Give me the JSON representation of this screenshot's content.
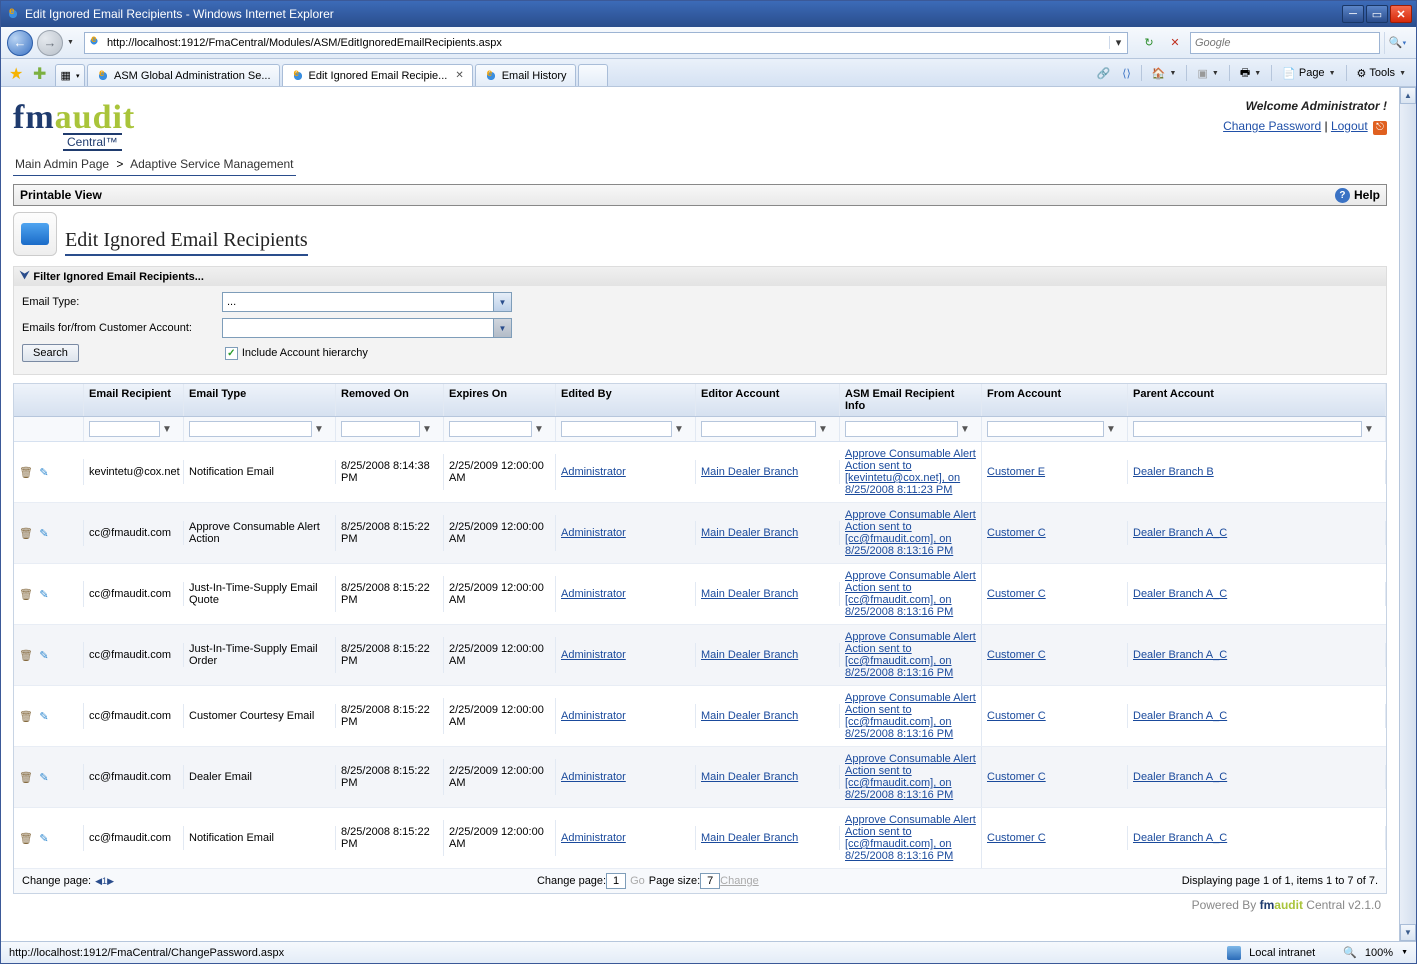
{
  "window": {
    "title": "Edit Ignored Email Recipients - Windows Internet Explorer"
  },
  "nav": {
    "url": "http://localhost:1912/FmaCentral/Modules/ASM/EditIgnoredEmailRecipients.aspx",
    "search_placeholder": "Google"
  },
  "tabs": [
    {
      "label": "ASM Global Administration Se..."
    },
    {
      "label": "Edit Ignored Email Recipie..."
    },
    {
      "label": "Email History"
    }
  ],
  "tools": {
    "page": "Page",
    "tools": "Tools"
  },
  "header": {
    "logo_fm": "fm",
    "logo_audit": "audit",
    "logo_sub": "Central™",
    "welcome": "Welcome Administrator !",
    "change_password": "Change Password",
    "logout": "Logout"
  },
  "breadcrumb": {
    "main": "Main Admin Page",
    "sep": ">",
    "current": "Adaptive Service Management"
  },
  "printable": {
    "label": "Printable View",
    "help": "Help"
  },
  "page_title": "Edit Ignored Email Recipients",
  "filter": {
    "header": "Filter Ignored Email Recipients...",
    "email_type_label": "Email Type:",
    "email_type_value": "...",
    "account_label": "Emails for/from Customer Account:",
    "account_value": "",
    "include_label": "Include Account hierarchy",
    "search_button": "Search"
  },
  "grid": {
    "columns": {
      "recipient": "Email Recipient",
      "type": "Email Type",
      "removed": "Removed On",
      "expires": "Expires On",
      "editedby": "Edited By",
      "editoracct": "Editor Account",
      "info": "ASM Email Recipient Info",
      "from": "From Account",
      "parent": "Parent Account"
    },
    "rows": [
      {
        "recipient": "kevintetu@cox.net",
        "type": "Notification Email",
        "removed": "8/25/2008 8:14:38 PM",
        "expires": "2/25/2009 12:00:00 AM",
        "editedby": "Administrator",
        "editoracct": "Main Dealer Branch",
        "info": "Approve Consumable Alert Action sent to [kevintetu@cox.net], on 8/25/2008 8:11:23 PM",
        "from": "Customer E",
        "parent": "Dealer Branch B"
      },
      {
        "recipient": "cc@fmaudit.com",
        "type": "Approve Consumable Alert Action",
        "removed": "8/25/2008 8:15:22 PM",
        "expires": "2/25/2009 12:00:00 AM",
        "editedby": "Administrator",
        "editoracct": "Main Dealer Branch",
        "info": "Approve Consumable Alert Action sent to [cc@fmaudit.com], on 8/25/2008 8:13:16 PM",
        "from": "Customer C",
        "parent": "Dealer Branch A_C"
      },
      {
        "recipient": "cc@fmaudit.com",
        "type": "Just-In-Time-Supply Email Quote",
        "removed": "8/25/2008 8:15:22 PM",
        "expires": "2/25/2009 12:00:00 AM",
        "editedby": "Administrator",
        "editoracct": "Main Dealer Branch",
        "info": "Approve Consumable Alert Action sent to [cc@fmaudit.com], on 8/25/2008 8:13:16 PM",
        "from": "Customer C",
        "parent": "Dealer Branch A_C"
      },
      {
        "recipient": "cc@fmaudit.com",
        "type": "Just-In-Time-Supply Email Order",
        "removed": "8/25/2008 8:15:22 PM",
        "expires": "2/25/2009 12:00:00 AM",
        "editedby": "Administrator",
        "editoracct": "Main Dealer Branch",
        "info": "Approve Consumable Alert Action sent to [cc@fmaudit.com], on 8/25/2008 8:13:16 PM",
        "from": "Customer C",
        "parent": "Dealer Branch A_C"
      },
      {
        "recipient": "cc@fmaudit.com",
        "type": "Customer Courtesy Email",
        "removed": "8/25/2008 8:15:22 PM",
        "expires": "2/25/2009 12:00:00 AM",
        "editedby": "Administrator",
        "editoracct": "Main Dealer Branch",
        "info": "Approve Consumable Alert Action sent to [cc@fmaudit.com], on 8/25/2008 8:13:16 PM",
        "from": "Customer C",
        "parent": "Dealer Branch A_C"
      },
      {
        "recipient": "cc@fmaudit.com",
        "type": "Dealer Email",
        "removed": "8/25/2008 8:15:22 PM",
        "expires": "2/25/2009 12:00:00 AM",
        "editedby": "Administrator",
        "editoracct": "Main Dealer Branch",
        "info": "Approve Consumable Alert Action sent to [cc@fmaudit.com], on 8/25/2008 8:13:16 PM",
        "from": "Customer C",
        "parent": "Dealer Branch A_C"
      },
      {
        "recipient": "cc@fmaudit.com",
        "type": "Notification Email",
        "removed": "8/25/2008 8:15:22 PM",
        "expires": "2/25/2009 12:00:00 AM",
        "editedby": "Administrator",
        "editoracct": "Main Dealer Branch",
        "info": "Approve Consumable Alert Action sent to [cc@fmaudit.com], on 8/25/2008 8:13:16 PM",
        "from": "Customer C",
        "parent": "Dealer Branch A_C"
      }
    ],
    "footer": {
      "change_page_left": "Change page:",
      "change_page_center": "Change page:",
      "page_value": "1",
      "go": "Go",
      "page_size_label": "Page size:",
      "page_size_value": "7",
      "change": "Change",
      "display": "Displaying page 1 of 1, items 1 to 7 of 7."
    }
  },
  "powered": {
    "prefix": "Powered By ",
    "fm": "fm",
    "audit": "audit",
    "suffix": " Central v2.1.0"
  },
  "status": {
    "url": "http://localhost:1912/FmaCentral/ChangePassword.aspx",
    "zone": "Local intranet",
    "zoom": "100%"
  }
}
